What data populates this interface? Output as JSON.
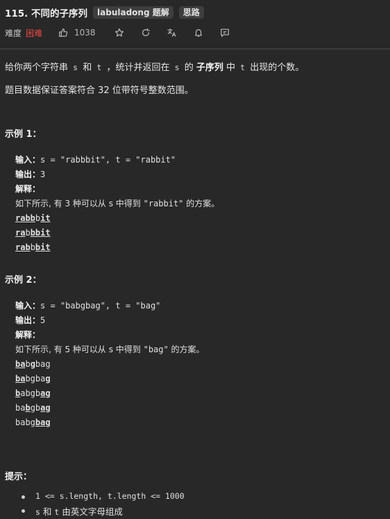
{
  "header": {
    "title": "115. 不同的子序列",
    "tags": [
      "labuladong 题解",
      "思路"
    ],
    "difficulty_label": "难度",
    "difficulty": "困难",
    "likes": "1038",
    "difficulty_color": "#ef4743"
  },
  "icons": [
    "thumbs-up-icon",
    "star-icon",
    "share-icon",
    "translate-icon",
    "bell-icon",
    "comment-icon"
  ],
  "description": {
    "line1": {
      "a": "给你两个字符串",
      "s": "s",
      "b": "和",
      "t": "t",
      "c": "，统计并返回在",
      "s2": "s",
      "d": "的",
      "e": "子序列",
      "f": "中",
      "t2": "t",
      "g": "出现的个数。"
    },
    "line2": "题目数据保证答案符合 32 位带符号整数范围。"
  },
  "example1": {
    "heading": "示例 1：",
    "input_label": "输入：",
    "input_value": "s = \"rabbbit\", t = \"rabbit\"",
    "output_label": "输出：",
    "output_value": "3",
    "explain_label": "解释：",
    "explain_a": "如下所示, 有 3 种可以从 s 中得到 ",
    "explain_b": "\"rabbit\"",
    "explain_c": " 的方案。",
    "lines": [
      [
        {
          "t": "rabb",
          "u": true
        },
        {
          "t": "b",
          "u": false
        },
        {
          "t": "it",
          "u": true
        }
      ],
      [
        {
          "t": "ra",
          "u": true
        },
        {
          "t": "b",
          "u": false
        },
        {
          "t": "bbit",
          "u": true
        }
      ],
      [
        {
          "t": "rab",
          "u": true
        },
        {
          "t": "b",
          "u": false
        },
        {
          "t": "bit",
          "u": true
        }
      ]
    ]
  },
  "example2": {
    "heading": "示例 2：",
    "input_label": "输入：",
    "input_value": "s = \"babgbag\", t = \"bag\"",
    "output_label": "输出：",
    "output_value": "5",
    "explain_label": "解释：",
    "explain_a": "如下所示, 有 5 种可以从 s 中得到 ",
    "explain_b": "\"bag\"",
    "explain_c": " 的方案。",
    "lines": [
      [
        {
          "t": "ba",
          "u": true
        },
        {
          "t": "b",
          "u": false
        },
        {
          "t": "g",
          "u": true
        },
        {
          "t": "bag",
          "u": false
        }
      ],
      [
        {
          "t": "ba",
          "u": true
        },
        {
          "t": "bgba",
          "u": false
        },
        {
          "t": "g",
          "u": true
        }
      ],
      [
        {
          "t": "b",
          "u": true
        },
        {
          "t": "abgb",
          "u": false
        },
        {
          "t": "ag",
          "u": true
        }
      ],
      [
        {
          "t": "ba",
          "u": false
        },
        {
          "t": "b",
          "u": true
        },
        {
          "t": "gb",
          "u": false
        },
        {
          "t": "ag",
          "u": true
        }
      ],
      [
        {
          "t": "babg",
          "u": false
        },
        {
          "t": "bag",
          "u": true
        }
      ]
    ]
  },
  "hints": {
    "heading": "提示：",
    "item1": "1 <= s.length, t.length <= 1000",
    "item2_s": "s",
    "item2_and": "和",
    "item2_t": "t",
    "item2_rest": "由英文字母组成"
  }
}
